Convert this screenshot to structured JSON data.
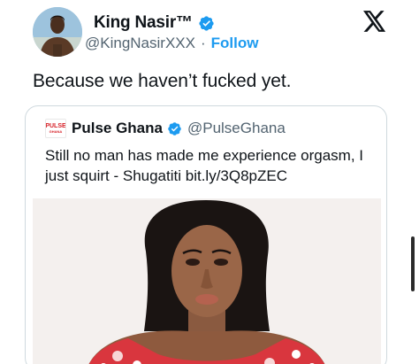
{
  "tweet": {
    "author": {
      "display_name": "King Nasir™",
      "handle": "@KingNasirXXX",
      "verified": true,
      "separator": "·",
      "follow_label": "Follow"
    },
    "text": "Because we haven’t fucked yet.",
    "platform_icon": "x-logo-icon"
  },
  "quoted_tweet": {
    "author": {
      "logo_text_top": "PULSE",
      "logo_text_bottom": "GHANA",
      "display_name": "Pulse Ghana",
      "handle": "@PulseGhana",
      "verified": true
    },
    "text": "Still no man has made me experience orgasm, I just squirt - Shugatiti bit.ly/3Q8pZEC",
    "media": {
      "type": "photo"
    }
  },
  "colors": {
    "accent": "#1d9bf0",
    "secondary_text": "#536471",
    "primary_text": "#0f1419",
    "border": "#cfd9de",
    "brand_red": "#d62027"
  }
}
